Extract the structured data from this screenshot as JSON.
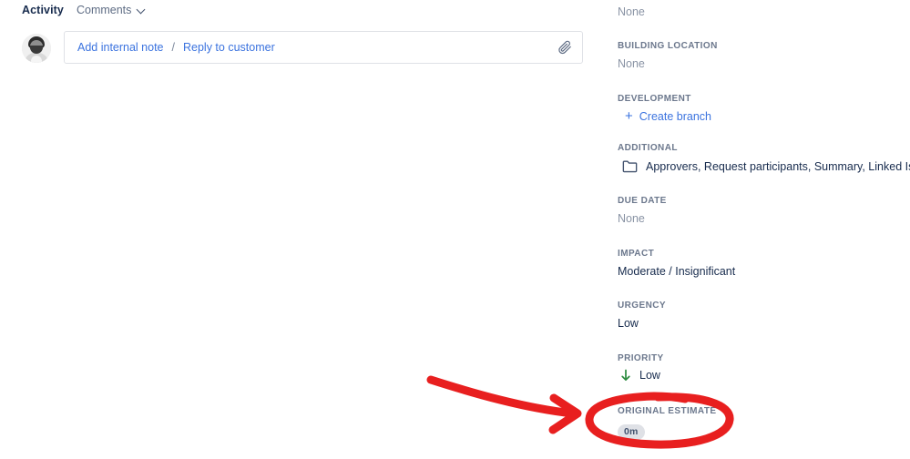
{
  "activity": {
    "tab_label": "Activity",
    "filter_selected": "Comments",
    "chevron_icon": "chevron-down-icon",
    "avatar_icon": "user-avatar",
    "comment_box": {
      "internal_note_label": "Add internal note",
      "separator": "/",
      "reply_label": "Reply to customer",
      "attach_icon": "paperclip-icon"
    }
  },
  "details": {
    "fields": [
      {
        "label": "",
        "value": "None",
        "muted": true,
        "icon": null
      },
      {
        "label": "BUILDING LOCATION",
        "value": "None",
        "muted": true,
        "icon": null
      },
      {
        "label": "DEVELOPMENT",
        "value": "Create branch",
        "muted": false,
        "link": true,
        "icon": "plus-icon"
      },
      {
        "label": "ADDITIONAL",
        "value": "Approvers, Request participants, Summary, Linked Is...",
        "muted": false,
        "icon": "folder-icon"
      },
      {
        "label": "DUE DATE",
        "value": "None",
        "muted": true,
        "icon": null
      },
      {
        "label": "IMPACT",
        "value": "Moderate / Insignificant",
        "muted": false,
        "icon": null
      },
      {
        "label": "URGENCY",
        "value": "Low",
        "muted": false,
        "icon": null
      },
      {
        "label": "PRIORITY",
        "value": "Low",
        "muted": false,
        "icon": "arrow-down-green-icon"
      },
      {
        "label": "ORIGINAL ESTIMATE",
        "value": "0m",
        "muted": false,
        "icon": null,
        "badge": true
      }
    ]
  },
  "annotation": {
    "color": "#e81f1f",
    "arrow_icon": "red-curved-arrow",
    "highlight_icon": "red-ellipse-highlight",
    "targets": "ORIGINAL ESTIMATE"
  },
  "colors": {
    "link": "#3b73df",
    "label": "#6b778c",
    "text": "#172b4d",
    "muted": "#8993a4",
    "annotation_red": "#e81f1f",
    "priority_green": "#2a8a3e"
  }
}
